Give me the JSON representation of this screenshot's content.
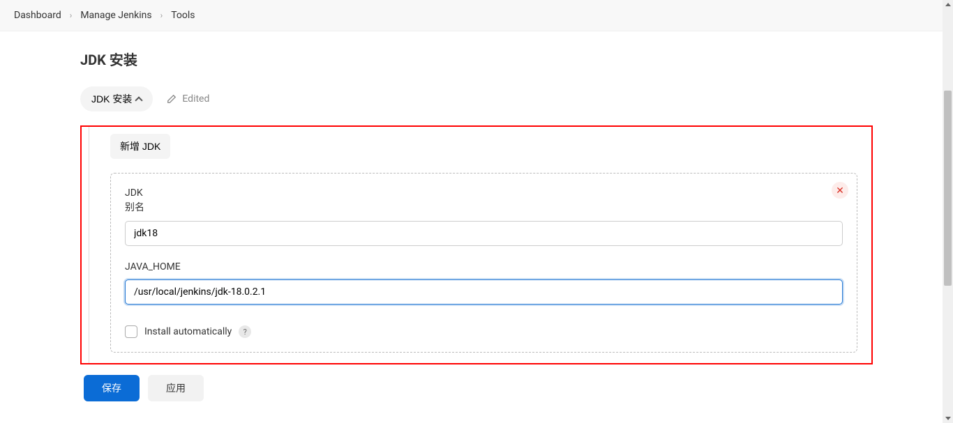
{
  "breadcrumb": {
    "items": [
      "Dashboard",
      "Manage Jenkins",
      "Tools"
    ]
  },
  "page": {
    "title": "JDK 安装"
  },
  "section": {
    "collapse_label": "JDK 安装",
    "edited_label": "Edited"
  },
  "jdk": {
    "add_button": "新增 JDK",
    "entry_label": "JDK",
    "alias_label": "别名",
    "alias_value": "jdk18",
    "java_home_label": "JAVA_HOME",
    "java_home_value": "/usr/local/jenkins/jdk-18.0.2.1",
    "install_auto_label": "Install automatically"
  },
  "buttons": {
    "save": "保存",
    "apply": "应用"
  }
}
